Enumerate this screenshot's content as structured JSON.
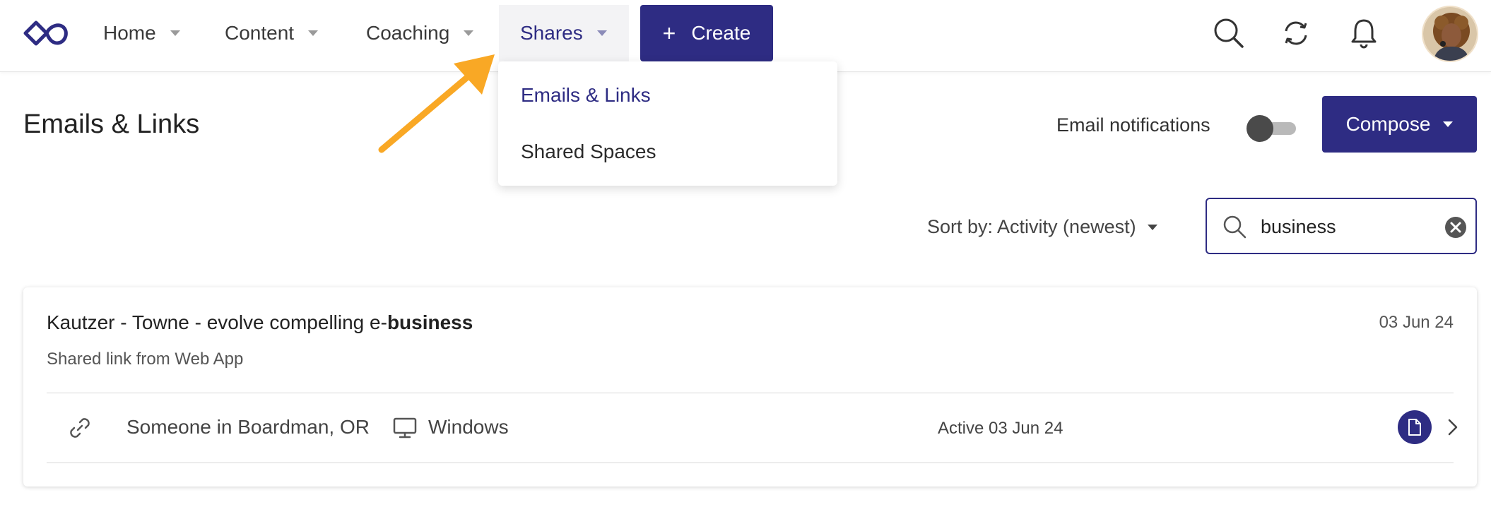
{
  "nav": {
    "items": [
      {
        "label": "Home"
      },
      {
        "label": "Content"
      },
      {
        "label": "Coaching"
      },
      {
        "label": "Shares"
      }
    ],
    "create_label": "Create",
    "create_symbol": "+"
  },
  "shares_dropdown": {
    "options": [
      {
        "label": "Emails & Links"
      },
      {
        "label": "Shared Spaces"
      }
    ]
  },
  "page": {
    "title": "Emails & Links",
    "email_notifications_label": "Email notifications",
    "email_notifications_on": false,
    "compose_label": "Compose"
  },
  "filters": {
    "sort_label": "Sort by: Activity (newest)",
    "search_value": "business"
  },
  "results": [
    {
      "title_prefix": "Kautzer - Towne - evolve compelling e-",
      "title_match": "business",
      "date": "03 Jun 24",
      "subtitle": "Shared link from Web App",
      "visitor": "Someone in Boardman, OR",
      "os": "Windows",
      "active": "Active 03 Jun 24"
    }
  ],
  "colors": {
    "brand": "#2e2c83",
    "annotation_arrow": "#f9a825"
  }
}
